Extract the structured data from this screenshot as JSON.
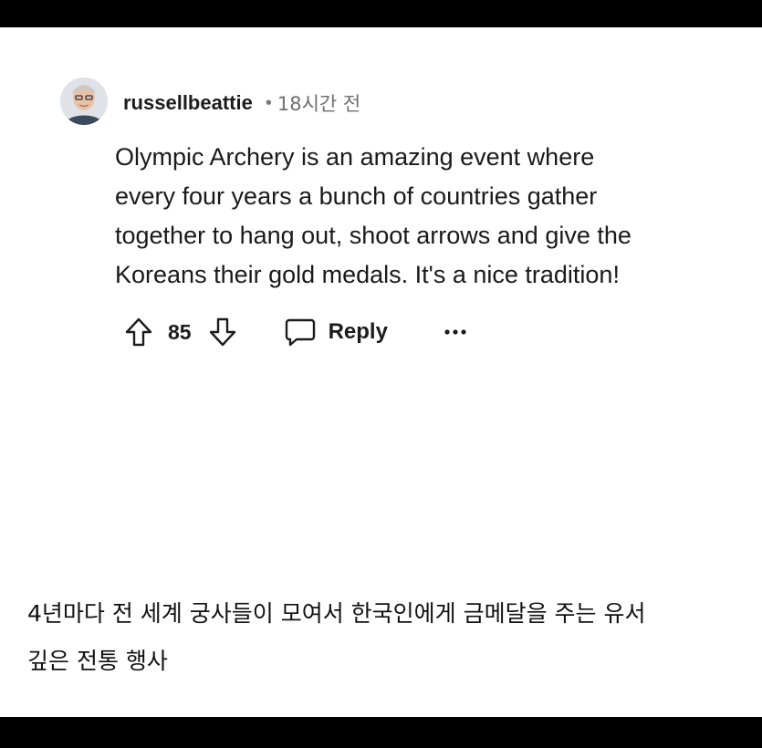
{
  "post": {
    "username": "russellbeattie",
    "separator": "•",
    "time": "18시간 전",
    "avatar_icon": "user-avatar-photo",
    "text": "Olympic Archery is an amazing event where\nevery four years a bunch of countries gather\ntogether to hang out, shoot arrows and give the\nKoreans their gold medals. It's a nice tradition!",
    "actions": {
      "upvote_icon": "arrow-up-icon",
      "score": "85",
      "downvote_icon": "arrow-down-icon",
      "reply_icon": "speech-bubble-icon",
      "reply_label": "Reply",
      "more_icon": "ellipsis-icon"
    }
  },
  "caption": {
    "text": "4년마다 전 세계 궁사들이 모여서 한국인에게 금메달을 주는 유서\n깊은 전통 행사"
  },
  "colors": {
    "background": "#ffffff",
    "frame": "#000000",
    "text": "#1a1a1b",
    "muted": "#6f6f6f"
  }
}
